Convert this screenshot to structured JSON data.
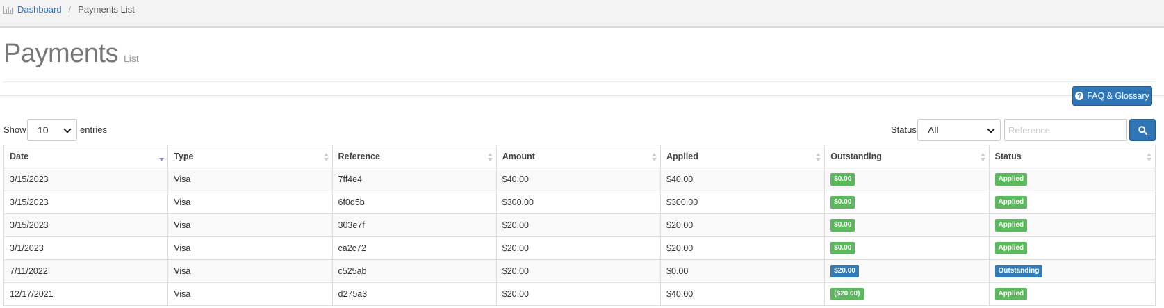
{
  "breadcrumb": {
    "home": "Dashboard",
    "separator": "/",
    "current": "Payments List"
  },
  "page": {
    "title": "Payments",
    "subtitle": "List"
  },
  "faq_button": {
    "label": "FAQ & Glossary",
    "icon": "question-circle-icon"
  },
  "length": {
    "show_label": "Show",
    "selected": "10",
    "entries_label": "entries"
  },
  "filter": {
    "status_label": "Status",
    "status_selected": "All",
    "reference_placeholder": "Reference",
    "search_icon": "search-icon"
  },
  "colors": {
    "primary": "#3075b5",
    "success": "#5cb85c",
    "info": "#337ab7",
    "link": "#2a6fc1"
  },
  "table": {
    "columns": [
      "Date",
      "Type",
      "Reference",
      "Amount",
      "Applied",
      "Outstanding",
      "Status"
    ],
    "rows": [
      {
        "date": "3/15/2023",
        "type": "Visa",
        "reference": "7ff4e4",
        "amount": "$40.00",
        "applied": "$40.00",
        "outstanding": "$0.00",
        "outstanding_color": "green",
        "status": "Applied",
        "status_color": "green"
      },
      {
        "date": "3/15/2023",
        "type": "Visa",
        "reference": "6f0d5b",
        "amount": "$300.00",
        "applied": "$300.00",
        "outstanding": "$0.00",
        "outstanding_color": "green",
        "status": "Applied",
        "status_color": "green"
      },
      {
        "date": "3/15/2023",
        "type": "Visa",
        "reference": "303e7f",
        "amount": "$20.00",
        "applied": "$20.00",
        "outstanding": "$0.00",
        "outstanding_color": "green",
        "status": "Applied",
        "status_color": "green"
      },
      {
        "date": "3/1/2023",
        "type": "Visa",
        "reference": "ca2c72",
        "amount": "$20.00",
        "applied": "$20.00",
        "outstanding": "$0.00",
        "outstanding_color": "green",
        "status": "Applied",
        "status_color": "green"
      },
      {
        "date": "7/11/2022",
        "type": "Visa",
        "reference": "c525ab",
        "amount": "$20.00",
        "applied": "$0.00",
        "outstanding": "$20.00",
        "outstanding_color": "blue",
        "status": "Outstanding",
        "status_color": "blue"
      },
      {
        "date": "12/17/2021",
        "type": "Visa",
        "reference": "d275a3",
        "amount": "$20.00",
        "applied": "$40.00",
        "outstanding": "($20.00)",
        "outstanding_color": "green",
        "status": "Applied",
        "status_color": "green"
      }
    ]
  }
}
